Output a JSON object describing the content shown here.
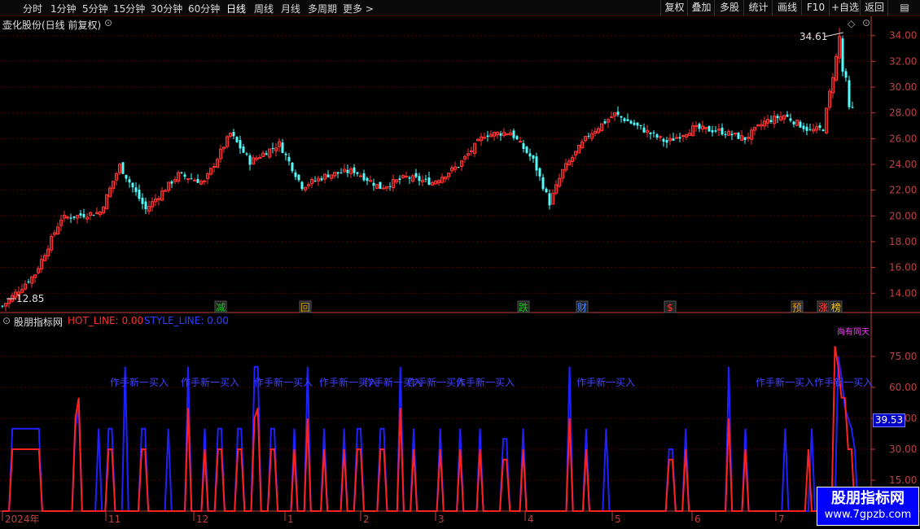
{
  "toolbar": {
    "periods": [
      "分时",
      "1分钟",
      "5分钟",
      "15分钟",
      "30分钟",
      "60分钟",
      "日线",
      "周线",
      "月线",
      "多周期",
      "更多 >"
    ],
    "active_period": "日线",
    "right_buttons": [
      "复权",
      "叠加",
      "多股",
      "统计",
      "画线",
      "F10",
      "+自选",
      "返回"
    ]
  },
  "main_title": "壶化股份(日线 前复权)",
  "price_labels": {
    "high": "34.61",
    "low": "12.85"
  },
  "events": [
    {
      "text": "减",
      "color": "#1fc01f",
      "idx": 67
    },
    {
      "text": "回",
      "color": "#d0a000",
      "idx": 93
    },
    {
      "text": "跌",
      "color": "#1fc01f",
      "idx": 160
    },
    {
      "text": "财",
      "color": "#4080ff",
      "idx": 178
    },
    {
      "text": "$",
      "color": "#ff3030",
      "idx": 205
    },
    {
      "text": "预",
      "color": "#ff9900",
      "idx": 244
    },
    {
      "text": "涨",
      "color": "#ff4040",
      "idx": 252
    },
    {
      "text": "榜",
      "color": "#ffcc00",
      "idx": 256
    }
  ],
  "indicator": {
    "name": "股朋指标网",
    "hot_label": "HOT_LINE: 0.00",
    "style_label": "STYLE_LINE: 0.00",
    "current_value": "39.53",
    "annotation_text": "作手新一买入",
    "top_annotation": "尚有同天"
  },
  "time_axis": [
    "2024年",
    "11",
    "12",
    "1",
    "2",
    "3",
    "4",
    "5",
    "6",
    "7"
  ],
  "watermark": {
    "line1": "股朋指标网",
    "line2": "www.7gpzb.com"
  },
  "colors": {
    "up": "#ff3232",
    "down": "#54fcfc",
    "hot": "#ff2020",
    "style": "#2020ff",
    "grid": "#5a0000",
    "axis": "#c04040"
  },
  "chart_data": [
    {
      "type": "candlestick",
      "title": "壶化股份(日线 前复权)",
      "ylim": [
        12.5,
        35.5
      ],
      "yticks": [
        14,
        16,
        18,
        20,
        22,
        24,
        26,
        28,
        30,
        32,
        34
      ],
      "annotations": [
        {
          "text": "34.61",
          "value": 34.61
        },
        {
          "text": "12.85",
          "value": 12.85
        }
      ],
      "close_anchors": [
        [
          0,
          13.0
        ],
        [
          10,
          15.5
        ],
        [
          18,
          19.8
        ],
        [
          30,
          20.3
        ],
        [
          36,
          23.9
        ],
        [
          44,
          20.5
        ],
        [
          54,
          23.2
        ],
        [
          62,
          22.6
        ],
        [
          70,
          26.4
        ],
        [
          76,
          24.2
        ],
        [
          85,
          25.6
        ],
        [
          92,
          22.3
        ],
        [
          100,
          23.2
        ],
        [
          108,
          23.5
        ],
        [
          116,
          22.2
        ],
        [
          124,
          23.0
        ],
        [
          132,
          22.6
        ],
        [
          140,
          23.9
        ],
        [
          148,
          26.3
        ],
        [
          156,
          26.5
        ],
        [
          163,
          24.3
        ],
        [
          168,
          21.0
        ],
        [
          172,
          23.5
        ],
        [
          180,
          26.3
        ],
        [
          188,
          27.9
        ],
        [
          196,
          26.8
        ],
        [
          204,
          25.7
        ],
        [
          212,
          26.8
        ],
        [
          220,
          26.6
        ],
        [
          228,
          26.0
        ],
        [
          234,
          27.3
        ],
        [
          240,
          27.8
        ],
        [
          248,
          26.6
        ],
        [
          252,
          26.8
        ],
        [
          256,
          32.3
        ],
        [
          257,
          33.9
        ],
        [
          258,
          31.2
        ],
        [
          259,
          30.5
        ],
        [
          260,
          28.3
        ]
      ]
    },
    {
      "type": "line",
      "title": "股朋指标网",
      "ylim": [
        0,
        90
      ],
      "yticks": [
        15,
        30,
        45,
        60,
        75
      ],
      "series": [
        {
          "name": "HOT_LINE",
          "color": "#ff2020",
          "values": [
            0,
            0,
            0,
            30,
            30,
            30,
            30,
            30,
            30,
            30,
            30,
            30,
            0,
            0,
            0,
            0,
            0,
            0,
            0,
            0,
            0,
            0,
            45,
            55,
            0,
            0,
            0,
            0,
            0,
            0,
            0,
            0,
            30,
            30,
            0,
            0,
            0,
            0,
            0,
            0,
            0,
            0,
            30,
            30,
            0,
            0,
            0,
            0,
            0,
            0,
            0,
            0,
            0,
            0,
            0,
            0,
            50,
            0,
            0,
            0,
            0,
            30,
            0,
            0,
            0,
            30,
            30,
            0,
            0,
            0,
            0,
            30,
            30,
            0,
            0,
            0,
            45,
            50,
            0,
            0,
            0,
            30,
            30,
            0,
            0,
            0,
            0,
            0,
            30,
            0,
            0,
            0,
            45,
            0,
            0,
            0,
            0,
            30,
            0,
            0,
            0,
            0,
            0,
            30,
            0,
            0,
            0,
            30,
            30,
            0,
            0,
            0,
            0,
            0,
            30,
            30,
            0,
            0,
            0,
            0,
            50,
            0,
            0,
            0,
            30,
            0,
            0,
            0,
            0,
            0,
            0,
            0,
            30,
            0,
            0,
            0,
            0,
            0,
            30,
            0,
            0,
            0,
            0,
            0,
            30,
            0,
            0,
            0,
            0,
            0,
            0,
            25,
            25,
            0,
            0,
            0,
            0,
            30,
            0,
            0,
            0,
            0,
            0,
            0,
            0,
            0,
            0,
            0,
            0,
            0,
            0,
            45,
            0,
            0,
            0,
            0,
            30,
            0,
            0,
            0,
            0,
            0,
            0,
            0,
            0,
            0,
            0,
            0,
            0,
            0,
            0,
            0,
            0,
            0,
            0,
            0,
            0,
            0,
            0,
            0,
            0,
            25,
            25,
            0,
            0,
            0,
            30,
            0,
            0,
            0,
            0,
            0,
            0,
            0,
            0,
            0,
            0,
            0,
            0,
            45,
            0,
            0,
            0,
            0,
            30,
            0,
            0,
            0,
            0,
            0,
            0,
            0,
            0,
            0,
            0,
            0,
            0,
            0,
            0,
            0,
            0,
            0,
            0,
            30,
            0,
            0,
            0,
            0,
            0,
            0,
            0,
            80,
            70,
            55,
            55,
            30,
            30,
            0,
            0
          ]
        },
        {
          "name": "STYLE_LINE",
          "color": "#2020ff",
          "values": [
            0,
            0,
            0,
            40,
            40,
            40,
            40,
            40,
            40,
            40,
            40,
            40,
            0,
            0,
            0,
            0,
            0,
            0,
            0,
            0,
            0,
            0,
            40,
            50,
            0,
            0,
            0,
            0,
            0,
            40,
            0,
            0,
            40,
            40,
            0,
            0,
            0,
            70,
            0,
            0,
            0,
            0,
            40,
            40,
            0,
            0,
            0,
            0,
            0,
            0,
            40,
            0,
            0,
            0,
            0,
            0,
            70,
            0,
            0,
            0,
            0,
            40,
            0,
            0,
            0,
            40,
            40,
            0,
            0,
            0,
            0,
            40,
            40,
            0,
            0,
            0,
            70,
            70,
            0,
            0,
            0,
            40,
            40,
            0,
            0,
            0,
            0,
            0,
            40,
            0,
            0,
            0,
            70,
            0,
            0,
            0,
            0,
            40,
            0,
            0,
            0,
            0,
            0,
            40,
            0,
            0,
            0,
            40,
            40,
            0,
            0,
            0,
            0,
            0,
            40,
            40,
            0,
            0,
            0,
            0,
            70,
            0,
            0,
            0,
            40,
            0,
            0,
            0,
            0,
            0,
            0,
            0,
            40,
            0,
            0,
            0,
            0,
            0,
            40,
            0,
            0,
            0,
            0,
            0,
            40,
            0,
            0,
            0,
            0,
            0,
            0,
            35,
            35,
            0,
            0,
            0,
            0,
            40,
            0,
            0,
            0,
            0,
            0,
            0,
            0,
            0,
            0,
            0,
            0,
            0,
            0,
            70,
            0,
            0,
            0,
            0,
            40,
            0,
            0,
            0,
            0,
            0,
            40,
            0,
            0,
            0,
            0,
            0,
            0,
            0,
            0,
            0,
            0,
            0,
            0,
            0,
            0,
            0,
            0,
            0,
            0,
            30,
            30,
            0,
            0,
            0,
            40,
            0,
            0,
            0,
            0,
            0,
            0,
            0,
            0,
            0,
            0,
            0,
            0,
            70,
            0,
            0,
            0,
            0,
            40,
            0,
            0,
            0,
            0,
            0,
            0,
            0,
            0,
            0,
            0,
            0,
            40,
            0,
            0,
            0,
            0,
            0,
            0,
            0,
            40,
            0,
            0,
            0,
            0,
            0,
            0,
            0,
            75,
            65,
            50,
            45,
            40,
            30,
            0,
            0
          ]
        }
      ]
    }
  ]
}
